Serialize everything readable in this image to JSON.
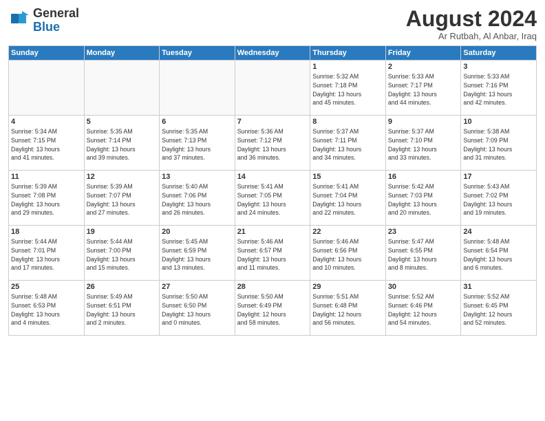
{
  "logo": {
    "general": "General",
    "blue": "Blue"
  },
  "title": "August 2024",
  "subtitle": "Ar Rutbah, Al Anbar, Iraq",
  "days_of_week": [
    "Sunday",
    "Monday",
    "Tuesday",
    "Wednesday",
    "Thursday",
    "Friday",
    "Saturday"
  ],
  "weeks": [
    [
      {
        "day": "",
        "info": ""
      },
      {
        "day": "",
        "info": ""
      },
      {
        "day": "",
        "info": ""
      },
      {
        "day": "",
        "info": ""
      },
      {
        "day": "1",
        "info": "Sunrise: 5:32 AM\nSunset: 7:18 PM\nDaylight: 13 hours\nand 45 minutes."
      },
      {
        "day": "2",
        "info": "Sunrise: 5:33 AM\nSunset: 7:17 PM\nDaylight: 13 hours\nand 44 minutes."
      },
      {
        "day": "3",
        "info": "Sunrise: 5:33 AM\nSunset: 7:16 PM\nDaylight: 13 hours\nand 42 minutes."
      }
    ],
    [
      {
        "day": "4",
        "info": "Sunrise: 5:34 AM\nSunset: 7:15 PM\nDaylight: 13 hours\nand 41 minutes."
      },
      {
        "day": "5",
        "info": "Sunrise: 5:35 AM\nSunset: 7:14 PM\nDaylight: 13 hours\nand 39 minutes."
      },
      {
        "day": "6",
        "info": "Sunrise: 5:35 AM\nSunset: 7:13 PM\nDaylight: 13 hours\nand 37 minutes."
      },
      {
        "day": "7",
        "info": "Sunrise: 5:36 AM\nSunset: 7:12 PM\nDaylight: 13 hours\nand 36 minutes."
      },
      {
        "day": "8",
        "info": "Sunrise: 5:37 AM\nSunset: 7:11 PM\nDaylight: 13 hours\nand 34 minutes."
      },
      {
        "day": "9",
        "info": "Sunrise: 5:37 AM\nSunset: 7:10 PM\nDaylight: 13 hours\nand 33 minutes."
      },
      {
        "day": "10",
        "info": "Sunrise: 5:38 AM\nSunset: 7:09 PM\nDaylight: 13 hours\nand 31 minutes."
      }
    ],
    [
      {
        "day": "11",
        "info": "Sunrise: 5:39 AM\nSunset: 7:08 PM\nDaylight: 13 hours\nand 29 minutes."
      },
      {
        "day": "12",
        "info": "Sunrise: 5:39 AM\nSunset: 7:07 PM\nDaylight: 13 hours\nand 27 minutes."
      },
      {
        "day": "13",
        "info": "Sunrise: 5:40 AM\nSunset: 7:06 PM\nDaylight: 13 hours\nand 26 minutes."
      },
      {
        "day": "14",
        "info": "Sunrise: 5:41 AM\nSunset: 7:05 PM\nDaylight: 13 hours\nand 24 minutes."
      },
      {
        "day": "15",
        "info": "Sunrise: 5:41 AM\nSunset: 7:04 PM\nDaylight: 13 hours\nand 22 minutes."
      },
      {
        "day": "16",
        "info": "Sunrise: 5:42 AM\nSunset: 7:03 PM\nDaylight: 13 hours\nand 20 minutes."
      },
      {
        "day": "17",
        "info": "Sunrise: 5:43 AM\nSunset: 7:02 PM\nDaylight: 13 hours\nand 19 minutes."
      }
    ],
    [
      {
        "day": "18",
        "info": "Sunrise: 5:44 AM\nSunset: 7:01 PM\nDaylight: 13 hours\nand 17 minutes."
      },
      {
        "day": "19",
        "info": "Sunrise: 5:44 AM\nSunset: 7:00 PM\nDaylight: 13 hours\nand 15 minutes."
      },
      {
        "day": "20",
        "info": "Sunrise: 5:45 AM\nSunset: 6:59 PM\nDaylight: 13 hours\nand 13 minutes."
      },
      {
        "day": "21",
        "info": "Sunrise: 5:46 AM\nSunset: 6:57 PM\nDaylight: 13 hours\nand 11 minutes."
      },
      {
        "day": "22",
        "info": "Sunrise: 5:46 AM\nSunset: 6:56 PM\nDaylight: 13 hours\nand 10 minutes."
      },
      {
        "day": "23",
        "info": "Sunrise: 5:47 AM\nSunset: 6:55 PM\nDaylight: 13 hours\nand 8 minutes."
      },
      {
        "day": "24",
        "info": "Sunrise: 5:48 AM\nSunset: 6:54 PM\nDaylight: 13 hours\nand 6 minutes."
      }
    ],
    [
      {
        "day": "25",
        "info": "Sunrise: 5:48 AM\nSunset: 6:53 PM\nDaylight: 13 hours\nand 4 minutes."
      },
      {
        "day": "26",
        "info": "Sunrise: 5:49 AM\nSunset: 6:51 PM\nDaylight: 13 hours\nand 2 minutes."
      },
      {
        "day": "27",
        "info": "Sunrise: 5:50 AM\nSunset: 6:50 PM\nDaylight: 13 hours\nand 0 minutes."
      },
      {
        "day": "28",
        "info": "Sunrise: 5:50 AM\nSunset: 6:49 PM\nDaylight: 12 hours\nand 58 minutes."
      },
      {
        "day": "29",
        "info": "Sunrise: 5:51 AM\nSunset: 6:48 PM\nDaylight: 12 hours\nand 56 minutes."
      },
      {
        "day": "30",
        "info": "Sunrise: 5:52 AM\nSunset: 6:46 PM\nDaylight: 12 hours\nand 54 minutes."
      },
      {
        "day": "31",
        "info": "Sunrise: 5:52 AM\nSunset: 6:45 PM\nDaylight: 12 hours\nand 52 minutes."
      }
    ]
  ]
}
